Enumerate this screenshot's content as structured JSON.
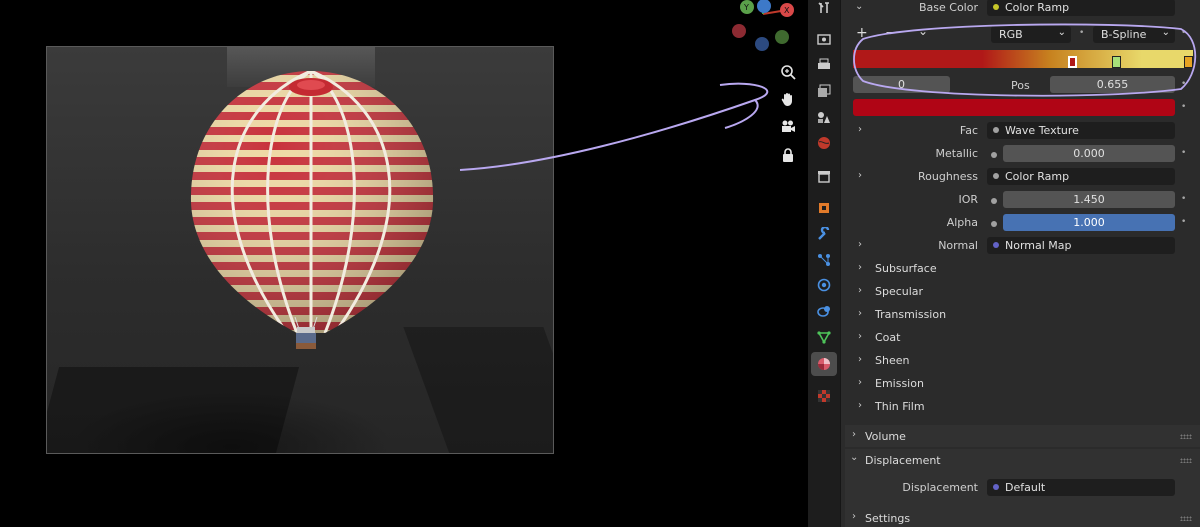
{
  "panel": {
    "base_color_label": "Base Color",
    "base_color_value": "Color Ramp",
    "ramp": {
      "add": "+",
      "remove": "−",
      "menu": "⌄",
      "color_mode": "RGB",
      "interpolation": "B-Spline",
      "index": "0",
      "pos_label": "Pos",
      "pos_value": "0.655"
    },
    "fac_label": "Fac",
    "fac_value": "Wave Texture",
    "metallic_label": "Metallic",
    "metallic_value": "0.000",
    "roughness_label": "Roughness",
    "roughness_value": "Color Ramp",
    "ior_label": "IOR",
    "ior_value": "1.450",
    "alpha_label": "Alpha",
    "alpha_value": "1.000",
    "normal_label": "Normal",
    "normal_value": "Normal Map",
    "subpanels": [
      "Subsurface",
      "Specular",
      "Transmission",
      "Coat",
      "Sheen",
      "Emission",
      "Thin Film"
    ],
    "volume_label": "Volume",
    "displacement_header": "Displacement",
    "displacement_label": "Displacement",
    "displacement_value": "Default",
    "settings_label": "Settings"
  },
  "gizmo": {
    "y": "Y",
    "x": "X"
  },
  "colors": {
    "accent_blue": "#4772b3",
    "ramp_red": "#b01818",
    "ramp_yellow": "#e8d86a",
    "socket_yellow": "#c7c729",
    "socket_gray": "#a1a1a1",
    "socket_purple": "#6363c7",
    "annotation": "#b9a8f0"
  },
  "icons": [
    "tool-icon",
    "render-icon",
    "output-icon",
    "view-layer-icon",
    "scene-icon",
    "world-icon",
    "collection-icon",
    "object-icon",
    "modifier-icon",
    "particles-icon",
    "physics-icon",
    "constraints-icon",
    "data-icon",
    "material-icon",
    "texture-icon",
    "zoom-icon",
    "hand-icon",
    "camera-icon",
    "lock-icon"
  ]
}
